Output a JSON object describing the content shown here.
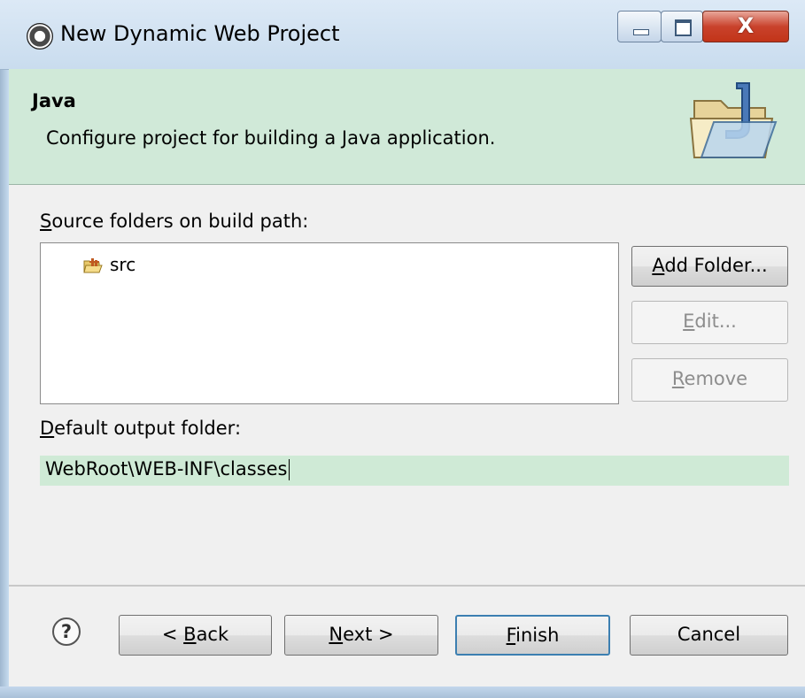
{
  "window": {
    "title": "New Dynamic Web Project",
    "controls": {
      "minimize_icon": "minimize-icon",
      "maximize_icon": "maximize-icon",
      "close_label": "X"
    }
  },
  "banner": {
    "title": "Java",
    "description": "Configure project for building a Java application.",
    "image_icon": "folder-java-wizard-icon",
    "background": "#d0e9d8"
  },
  "source_folders": {
    "label_underlined": "S",
    "label_rest": "ource folders on build path:",
    "items": [
      {
        "name": "src",
        "icon": "package-folder-icon"
      }
    ]
  },
  "side_buttons": {
    "add_folder": {
      "u": "A",
      "rest": "dd Folder..."
    },
    "edit": {
      "u": "E",
      "rest": "dit..."
    },
    "remove": {
      "u": "R",
      "rest": "emove"
    }
  },
  "output": {
    "label_underlined": "D",
    "label_rest": "efault output folder:",
    "value": "WebRoot\\WEB-INF\\classes"
  },
  "footer": {
    "help_symbol": "?",
    "back": {
      "pre": "< ",
      "u": "B",
      "rest": "ack"
    },
    "next": {
      "u": "N",
      "rest": "ext >"
    },
    "finish": {
      "u": "F",
      "rest": "inish"
    },
    "cancel": "Cancel"
  }
}
